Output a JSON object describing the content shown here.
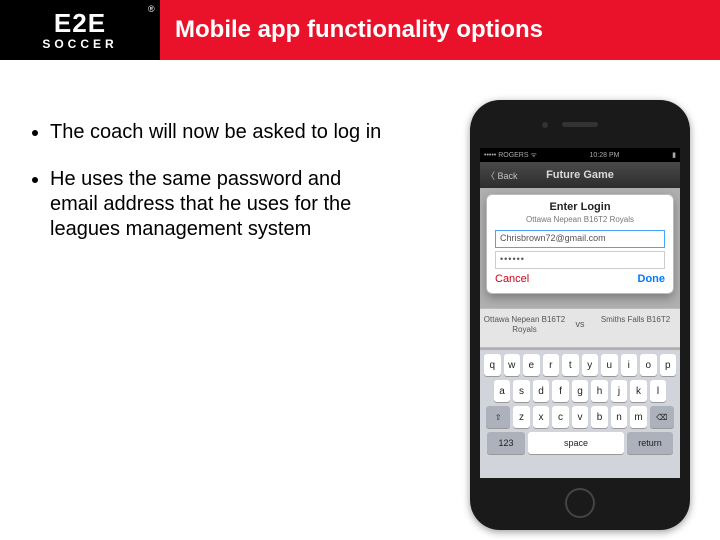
{
  "header": {
    "logo_main": "E2E",
    "logo_sub": "SOCCER",
    "reg": "®",
    "title": "Mobile app functionality options"
  },
  "bullets": [
    "The coach will now be asked to log in",
    "He uses the same password and email address that he uses for the leagues management system"
  ],
  "phone": {
    "status": {
      "left": "••••• ROGERS ᯤ",
      "center": "10:28 PM",
      "right": "▮"
    },
    "nav": {
      "back": "〈 Back",
      "title": "Future Game"
    },
    "login": {
      "title": "Enter Login",
      "subtitle": "Ottawa Nepean B16T2 Royals",
      "email": "Chrisbrown72@gmail.com",
      "password": "••••••",
      "cancel": "Cancel",
      "done": "Done"
    },
    "teams": {
      "left": "Ottawa Nepean\nB16T2 Royals",
      "vs": "vs",
      "right": "Smiths Falls\nB16T2"
    },
    "keyboard": {
      "row1": [
        "q",
        "w",
        "e",
        "r",
        "t",
        "y",
        "u",
        "i",
        "o",
        "p"
      ],
      "row2": [
        "a",
        "s",
        "d",
        "f",
        "g",
        "h",
        "j",
        "k",
        "l"
      ],
      "row3_shift": "⇧",
      "row3": [
        "z",
        "x",
        "c",
        "v",
        "b",
        "n",
        "m"
      ],
      "row3_del": "⌫",
      "row4": {
        "num": "123",
        "space": "space",
        "ret": "return"
      }
    }
  }
}
